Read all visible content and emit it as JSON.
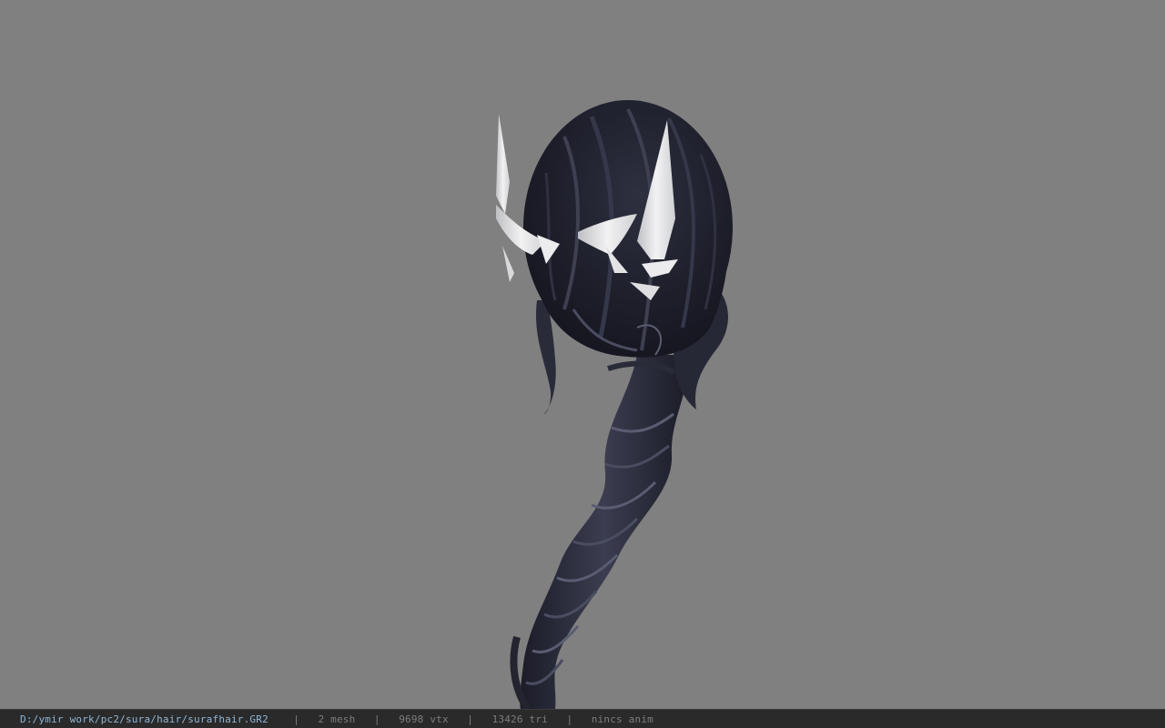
{
  "viewport": {
    "background_color": "#808080",
    "model_description": "hair-model-render"
  },
  "statusbar": {
    "file_path": "D:/ymir work/pc2/sura/hair/surafhair.GR2",
    "separator": "|",
    "mesh_count": "2 mesh",
    "vertex_count": "9698 vtx",
    "triangle_count": "13426 tri",
    "anim_status": "nincs anim"
  },
  "colors": {
    "hair_dark": "#1c1d28",
    "hair_mid": "#3a3c4e",
    "hair_light": "#5a5d72",
    "ornament": "#e6e6e8",
    "statusbar_bg": "#2a2a2a",
    "path_color": "#8fb6d8"
  }
}
